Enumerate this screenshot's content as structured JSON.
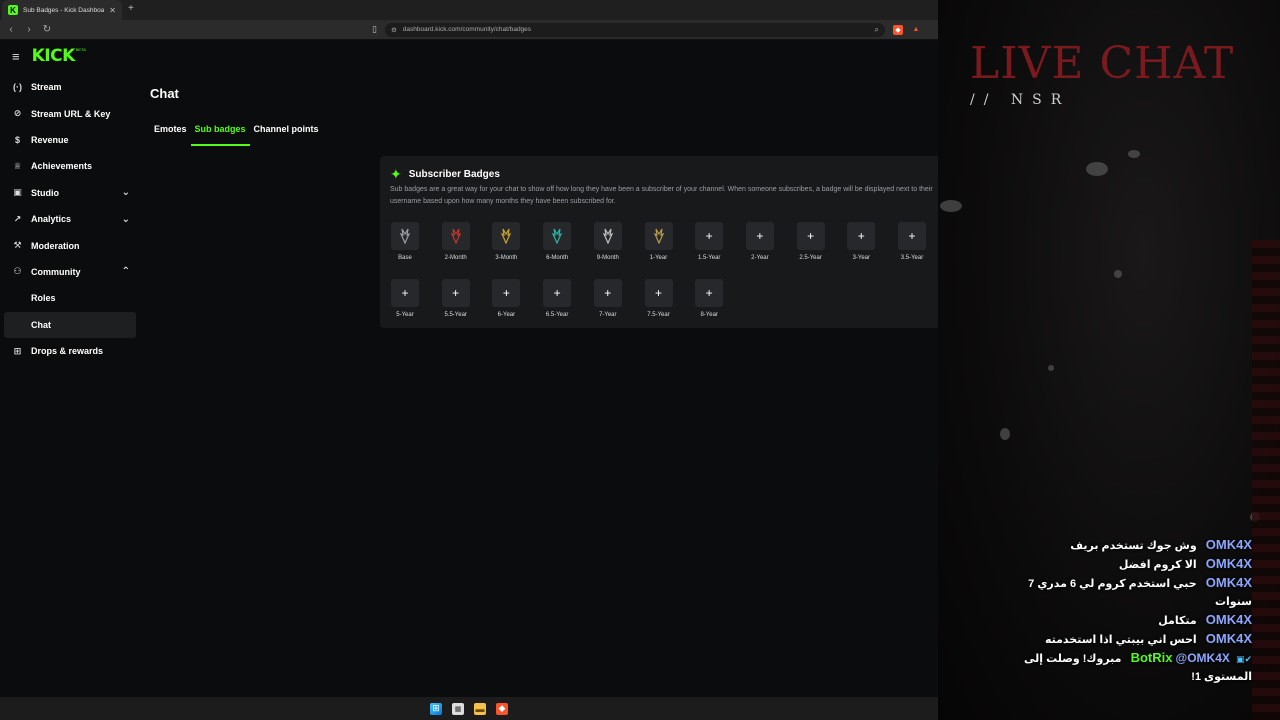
{
  "browser": {
    "tab_title": "Sub Badges - Kick Dashboard",
    "url": "dashboard.kick.com/community/chat/badges"
  },
  "brand": {
    "logo": "KICK",
    "beta": "BETA",
    "accent": "#53fc18"
  },
  "sidebar": {
    "items": [
      {
        "label": "Stream",
        "icon": "stream-icon"
      },
      {
        "label": "Stream URL & Key",
        "icon": "link-icon"
      },
      {
        "label": "Revenue",
        "icon": "revenue-icon"
      },
      {
        "label": "Achievements",
        "icon": "trophy-icon"
      },
      {
        "label": "Studio",
        "icon": "studio-icon"
      },
      {
        "label": "Analytics",
        "icon": "analytics-icon"
      },
      {
        "label": "Moderation",
        "icon": "hammer-icon"
      },
      {
        "label": "Community",
        "icon": "community-icon"
      },
      {
        "label": "Roles"
      },
      {
        "label": "Chat"
      },
      {
        "label": "Drops & rewards",
        "icon": "gift-icon"
      }
    ]
  },
  "main": {
    "title": "Chat",
    "tabs": [
      "Emotes",
      "Sub badges",
      "Channel points"
    ],
    "active_tab": "Sub badges"
  },
  "badges_card": {
    "title": "Subscriber Badges",
    "description": "Sub badges are a great way for your chat to show off how long they have been a subscriber of your channel. When someone subscribes, a badge will be displayed next to their username based upon how many months they have been subscribed for.",
    "badges": [
      {
        "label": "Base",
        "set": true,
        "color": "#9a9ea4"
      },
      {
        "label": "2-Month",
        "set": true,
        "color": "#c0392b"
      },
      {
        "label": "3-Month",
        "set": true,
        "color": "#c9a227"
      },
      {
        "label": "6-Month",
        "set": true,
        "color": "#2bb5a3"
      },
      {
        "label": "9-Month",
        "set": true,
        "color": "#bfbfbf"
      },
      {
        "label": "1-Year",
        "set": true,
        "color": "#b89a4a"
      },
      {
        "label": "1.5-Year",
        "set": false
      },
      {
        "label": "2-Year",
        "set": false
      },
      {
        "label": "2.5-Year",
        "set": false
      },
      {
        "label": "3-Year",
        "set": false
      },
      {
        "label": "3.5-Year",
        "set": false
      },
      {
        "label": "5-Year",
        "set": false
      },
      {
        "label": "5.5-Year",
        "set": false
      },
      {
        "label": "6-Year",
        "set": false
      },
      {
        "label": "6.5-Year",
        "set": false
      },
      {
        "label": "7-Year",
        "set": false
      },
      {
        "label": "7.5-Year",
        "set": false
      },
      {
        "label": "8-Year",
        "set": false
      }
    ]
  },
  "overlay": {
    "title": "LIVE CHAT",
    "subtitle": "// NSR",
    "chat": [
      {
        "user": "OMK4X",
        "text": "وش جوك تستخدم بريف"
      },
      {
        "user": "OMK4X",
        "text": "الا كروم افضل"
      },
      {
        "user": "OMK4X",
        "text": "حبي استخدم كروم لي 6 مدري 7 سنوات"
      },
      {
        "user": "OMK4X",
        "text": "متكامل"
      },
      {
        "user": "OMK4X",
        "text": "احس اني بيبتي اذا استخدمته"
      },
      {
        "user": "BotRix",
        "mention": "@OMK4X",
        "text": "مبروك! وصلت إلى المستوى 1!"
      }
    ]
  }
}
